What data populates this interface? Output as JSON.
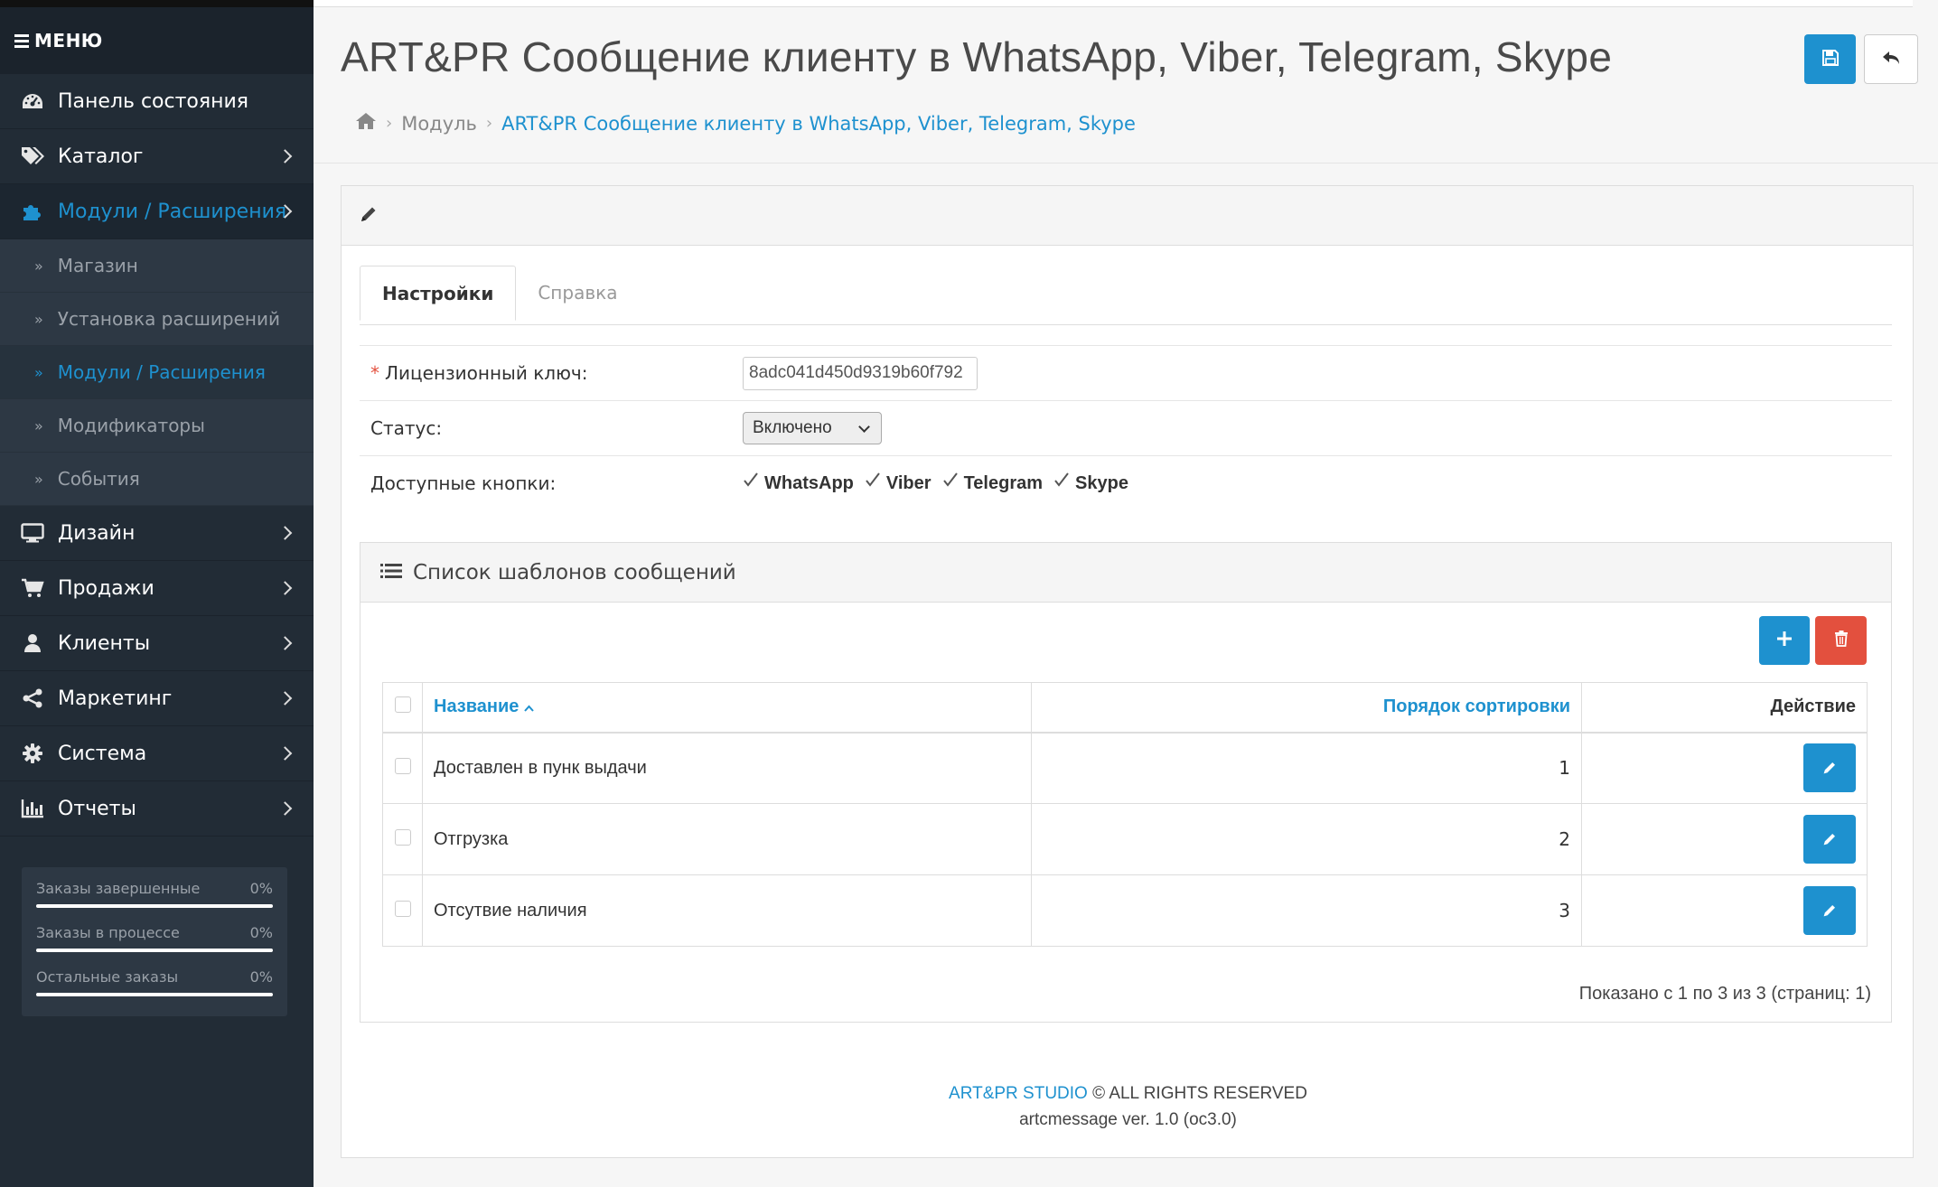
{
  "sidebar": {
    "menu_label": "МЕНЮ",
    "items": [
      {
        "label": "Панель состояния",
        "icon": "dashboard-icon"
      },
      {
        "label": "Каталог",
        "icon": "tags-icon"
      },
      {
        "label": "Модули / Расширения",
        "icon": "puzzle-icon"
      },
      {
        "label": "Дизайн",
        "icon": "desktop-icon"
      },
      {
        "label": "Продажи",
        "icon": "cart-icon"
      },
      {
        "label": "Клиенты",
        "icon": "user-icon"
      },
      {
        "label": "Маркетинг",
        "icon": "share-icon"
      },
      {
        "label": "Система",
        "icon": "gear-icon"
      },
      {
        "label": "Отчеты",
        "icon": "bar-chart-icon"
      }
    ],
    "subitems": [
      {
        "label": "Магазин"
      },
      {
        "label": "Установка расширений"
      },
      {
        "label": "Модули / Расширения"
      },
      {
        "label": "Модификаторы"
      },
      {
        "label": "События"
      }
    ],
    "stats": [
      {
        "label": "Заказы завершенные",
        "value": "0%"
      },
      {
        "label": "Заказы в процессе",
        "value": "0%"
      },
      {
        "label": "Остальные заказы",
        "value": "0%"
      }
    ]
  },
  "header": {
    "title": "ART&PR Сообщение клиенту в WhatsApp, Viber, Telegram, Skype",
    "breadcrumb": [
      "Модуль",
      "ART&PR Сообщение клиенту в WhatsApp, Viber, Telegram, Skype"
    ]
  },
  "tabs": [
    "Настройки",
    "Справка"
  ],
  "form": {
    "license_label": "Лицензионный ключ:",
    "license_value": "8adc041d450d9319b60f792",
    "status_label": "Статус:",
    "status_value": "Включено",
    "buttons_label": "Доступные кнопки:",
    "buttons": [
      "WhatsApp",
      "Viber",
      "Telegram",
      "Skype"
    ]
  },
  "templates": {
    "title": "Список шаблонов сообщений",
    "columns": {
      "name": "Название",
      "sort": "Порядок сортировки",
      "action": "Действие"
    },
    "rows": [
      {
        "name": "Доставлен в пунк выдачи",
        "sort": "1"
      },
      {
        "name": "Отгрузка",
        "sort": "2"
      },
      {
        "name": "Отсутвие наличия",
        "sort": "3"
      }
    ],
    "pagination": "Показано с 1 по 3 из 3 (страниц: 1)"
  },
  "footer": {
    "studio": "ART&PR STUDIO",
    "rights": " © ALL RIGHTS RESERVED",
    "version": "artcmessage ver. 1.0 (oc3.0)"
  },
  "colors": {
    "accent": "#1e91cf",
    "danger": "#e3503e",
    "sidebar": "#222c36"
  }
}
